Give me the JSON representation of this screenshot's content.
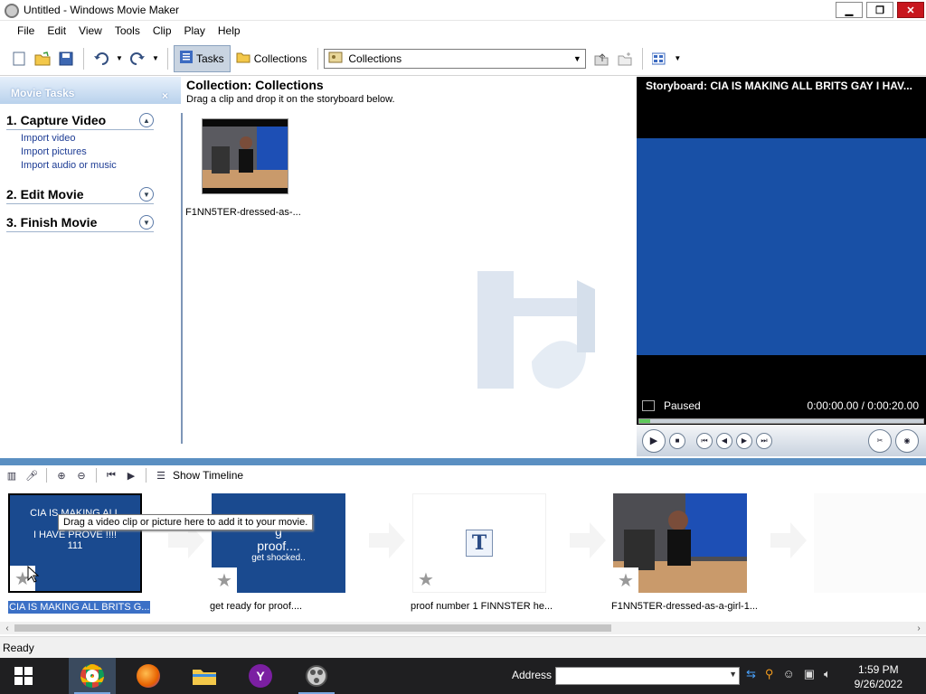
{
  "window": {
    "title": "Untitled - Windows Movie Maker",
    "minimize": "▁",
    "restore": "❐",
    "close": "✕"
  },
  "menu": [
    "File",
    "Edit",
    "View",
    "Tools",
    "Clip",
    "Play",
    "Help"
  ],
  "toolbar": {
    "tasks_label": "Tasks",
    "collections_label": "Collections",
    "collections_combo": "Collections"
  },
  "tasks": {
    "header": "Movie Tasks",
    "close": "×",
    "sections": [
      {
        "title": "1. Capture Video",
        "links": [
          "Import video",
          "Import pictures",
          "Import audio or music"
        ]
      },
      {
        "title": "2. Edit Movie",
        "links": []
      },
      {
        "title": "3. Finish Movie",
        "links": []
      }
    ]
  },
  "collection": {
    "title": "Collection: Collections",
    "subtitle": "Drag a clip and drop it on the storyboard below.",
    "clip_label": "F1NN5TER-dressed-as-..."
  },
  "preview": {
    "title": "Storyboard: CIA IS MAKING ALL BRITS GAY I HAV...",
    "status": "Paused",
    "time": "0:00:00.00 / 0:00:20.00",
    "progress_fraction": 0.0
  },
  "storyboard_toolbar": {
    "show_timeline": "Show Timeline"
  },
  "storyboard": {
    "tooltip": "Drag a video clip or picture here to add it to your movie.",
    "items": [
      {
        "text_lines": [
          "CIA IS MAKING ALL",
          "B",
          "I HAVE PROVE !!!!",
          "111"
        ],
        "label": "CIA IS MAKING ALL BRITS G..."
      },
      {
        "text_lines": [
          "g",
          "proof....",
          "get shocked.."
        ],
        "label": "get ready for proof...."
      },
      {
        "text_lines": [
          "T"
        ],
        "label": "proof number 1 FINNSTER he..."
      },
      {
        "text_lines": [],
        "label": "F1NN5TER-dressed-as-a-girl-1..."
      }
    ]
  },
  "status_bar": "Ready",
  "taskbar": {
    "address_label": "Address",
    "time": "1:59 PM",
    "date": "9/26/2022"
  },
  "colors": {
    "accent": "#5a8fc2",
    "preview_blue": "#1850a6",
    "storyboard_blue": "#1a4a8f",
    "taskbar": "#1f1f21"
  }
}
